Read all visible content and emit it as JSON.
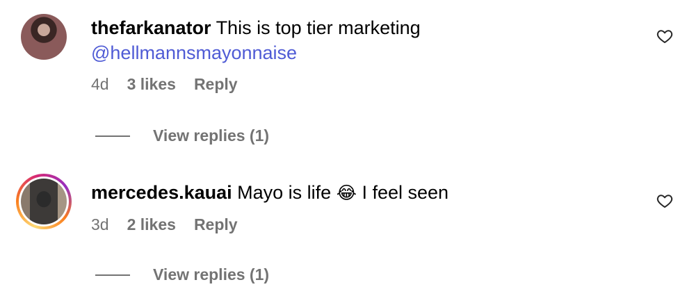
{
  "comments": [
    {
      "username": "thefarkanator",
      "text": "This is top tier marketing",
      "mention": "@hellmannsmayonnaise",
      "age": "4d",
      "likes": "3 likes",
      "reply": "Reply",
      "view_replies": "View replies (1)",
      "avatar_story_ring": false
    },
    {
      "username": "mercedes.kauai",
      "text_before": "Mayo is life",
      "emoji": "😂",
      "text_after": "I feel seen",
      "age": "3d",
      "likes": "2 likes",
      "reply": "Reply",
      "view_replies": "View replies (1)",
      "avatar_story_ring": true
    }
  ],
  "colors": {
    "mention": "#4f5bd5",
    "meta": "#737373",
    "text": "#000000"
  },
  "icons": [
    "heart-icon"
  ]
}
